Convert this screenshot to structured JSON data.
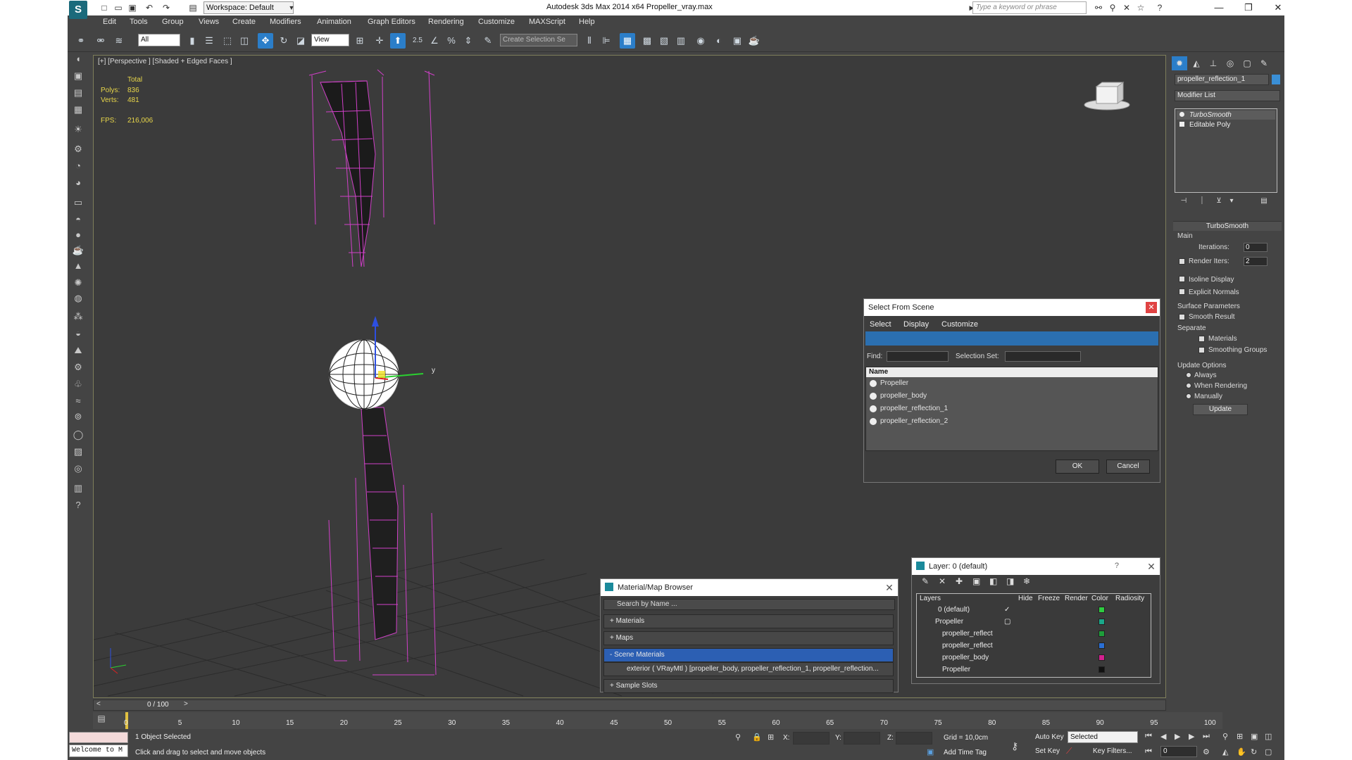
{
  "title_bar": {
    "workspace": "Workspace: Default",
    "app_title": "Autodesk 3ds Max  2014 x64     Propeller_vray.max",
    "search_placeholder": "Type a keyword or phrase"
  },
  "menu": [
    "Edit",
    "Tools",
    "Group",
    "Views",
    "Create",
    "Modifiers",
    "Animation",
    "Graph Editors",
    "Rendering",
    "Customize",
    "MAXScript",
    "Help"
  ],
  "toolbar": {
    "filter_value": "All",
    "ref_coord_value": "View",
    "selection_set_placeholder": "Create Selection Se",
    "angle_snap_label": "2.5"
  },
  "viewport": {
    "label": "[+] [Perspective ] [Shaded + Edged Faces ]",
    "stats_total": "Total",
    "polys_label": "Polys:",
    "polys_value": "836",
    "verts_label": "Verts:",
    "verts_value": "481",
    "fps_label": "FPS:",
    "fps_value": "216,006",
    "gizmo_y": "y"
  },
  "command_panel": {
    "object_name": "propeller_reflection_1",
    "object_color": "#3a8fd6",
    "modifier_list": "Modifier List",
    "stack": [
      "TurboSmooth",
      "Editable Poly"
    ],
    "rollout_title": "TurboSmooth",
    "main_label": "Main",
    "iterations_label": "Iterations:",
    "iterations_value": "0",
    "render_iters_label": "Render Iters:",
    "render_iters_value": "2",
    "isoline_label": "Isoline Display",
    "explicit_normals_label": "Explicit Normals",
    "surface_params_label": "Surface Parameters",
    "smooth_result_label": "Smooth Result",
    "separate_label": "Separate",
    "materials_label": "Materials",
    "smoothing_groups_label": "Smoothing Groups",
    "update_options_label": "Update Options",
    "always_label": "Always",
    "when_rendering_label": "When Rendering",
    "manually_label": "Manually",
    "update_button": "Update"
  },
  "select_from_scene": {
    "title": "Select From Scene",
    "menus": [
      "Select",
      "Display",
      "Customize"
    ],
    "find_label": "Find:",
    "selection_set_label": "Selection Set:",
    "column_name": "Name",
    "items": [
      "Propeller",
      "propeller_body",
      "propeller_reflection_1",
      "propeller_reflection_2"
    ],
    "ok": "OK",
    "cancel": "Cancel"
  },
  "material_browser": {
    "title": "Material/Map Browser",
    "search_placeholder": "Search by Name ...",
    "sections": [
      "+ Materials",
      "+ Maps",
      "- Scene Materials"
    ],
    "scene_material": "exterior ( VRayMtl ) [propeller_body, propeller_reflection_1, propeller_reflection...",
    "sample_slots": "+ Sample Slots"
  },
  "layer_dialog": {
    "title": "Layer: 0 (default)",
    "help": "?",
    "columns": [
      "Layers",
      "Hide",
      "Freeze",
      "Render",
      "Color",
      "Radiosity"
    ],
    "rows": [
      {
        "name": "0 (default)",
        "color": "#2ecc40"
      },
      {
        "name": "Propeller",
        "color": "#1aa88a"
      },
      {
        "name": "propeller_reflect",
        "color": "#1e9e3a"
      },
      {
        "name": "propeller_reflect",
        "color": "#2a6fd4"
      },
      {
        "name": "propeller_body",
        "color": "#d4208f"
      },
      {
        "name": "Propeller",
        "color": "#111111"
      }
    ]
  },
  "timeline": {
    "frame_label": "0 / 100",
    "ticks": [
      "0",
      "5",
      "10",
      "15",
      "20",
      "25",
      "30",
      "35",
      "40",
      "45",
      "50",
      "55",
      "60",
      "65",
      "70",
      "75",
      "80",
      "85",
      "90",
      "95",
      "100"
    ]
  },
  "status_bar": {
    "maxscript_text": "Welcome to M",
    "selection_status": "1 Object Selected",
    "prompt": "Click and drag to select and move objects",
    "x_label": "X:",
    "y_label": "Y:",
    "z_label": "Z:",
    "grid": "Grid = 10,0cm",
    "add_time_tag": "Add Time Tag",
    "auto_key": "Auto Key",
    "selected_value": "Selected",
    "set_key": "Set Key",
    "key_filters": "Key Filters...",
    "frame_value": "0"
  }
}
